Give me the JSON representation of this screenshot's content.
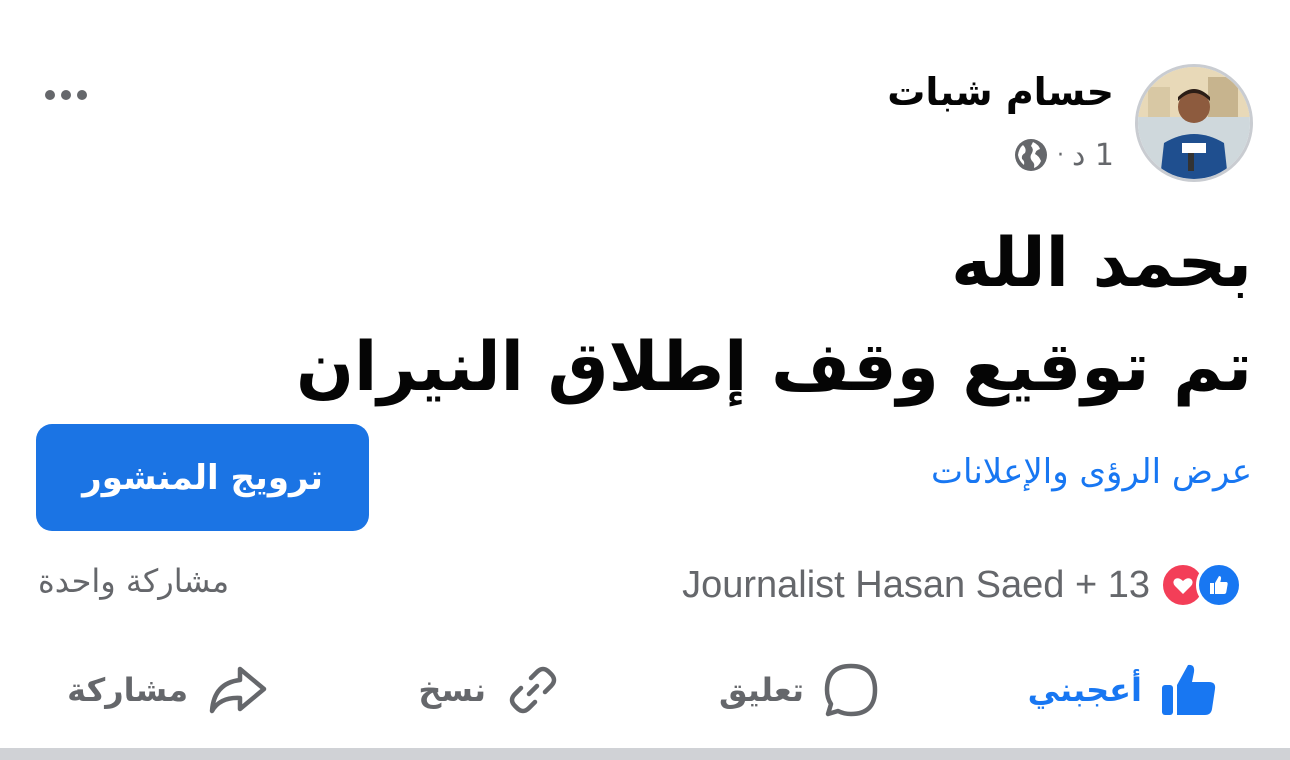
{
  "author": {
    "name": "حسام شبات",
    "timestamp": "1 د",
    "separator": "·",
    "audience_icon": "globe-icon"
  },
  "post": {
    "lines": [
      "بحمد الله",
      "تم توقيع وقف إطلاق النيران"
    ]
  },
  "insights_link": "عرض الرؤى والإعلانات",
  "promote_button": "ترويج المنشور",
  "reactions": {
    "icons": [
      "like-icon",
      "love-icon"
    ],
    "summary": "Journalist Hasan Saed + 13"
  },
  "shares": "مشاركة واحدة",
  "actions": {
    "like": "أعجبني",
    "comment": "تعليق",
    "copy": "نسخ",
    "share": "مشاركة"
  },
  "colors": {
    "accent": "#1877f2",
    "promote_bg": "#1b74e4",
    "muted_text": "#65676b",
    "love": "#f33e58"
  }
}
